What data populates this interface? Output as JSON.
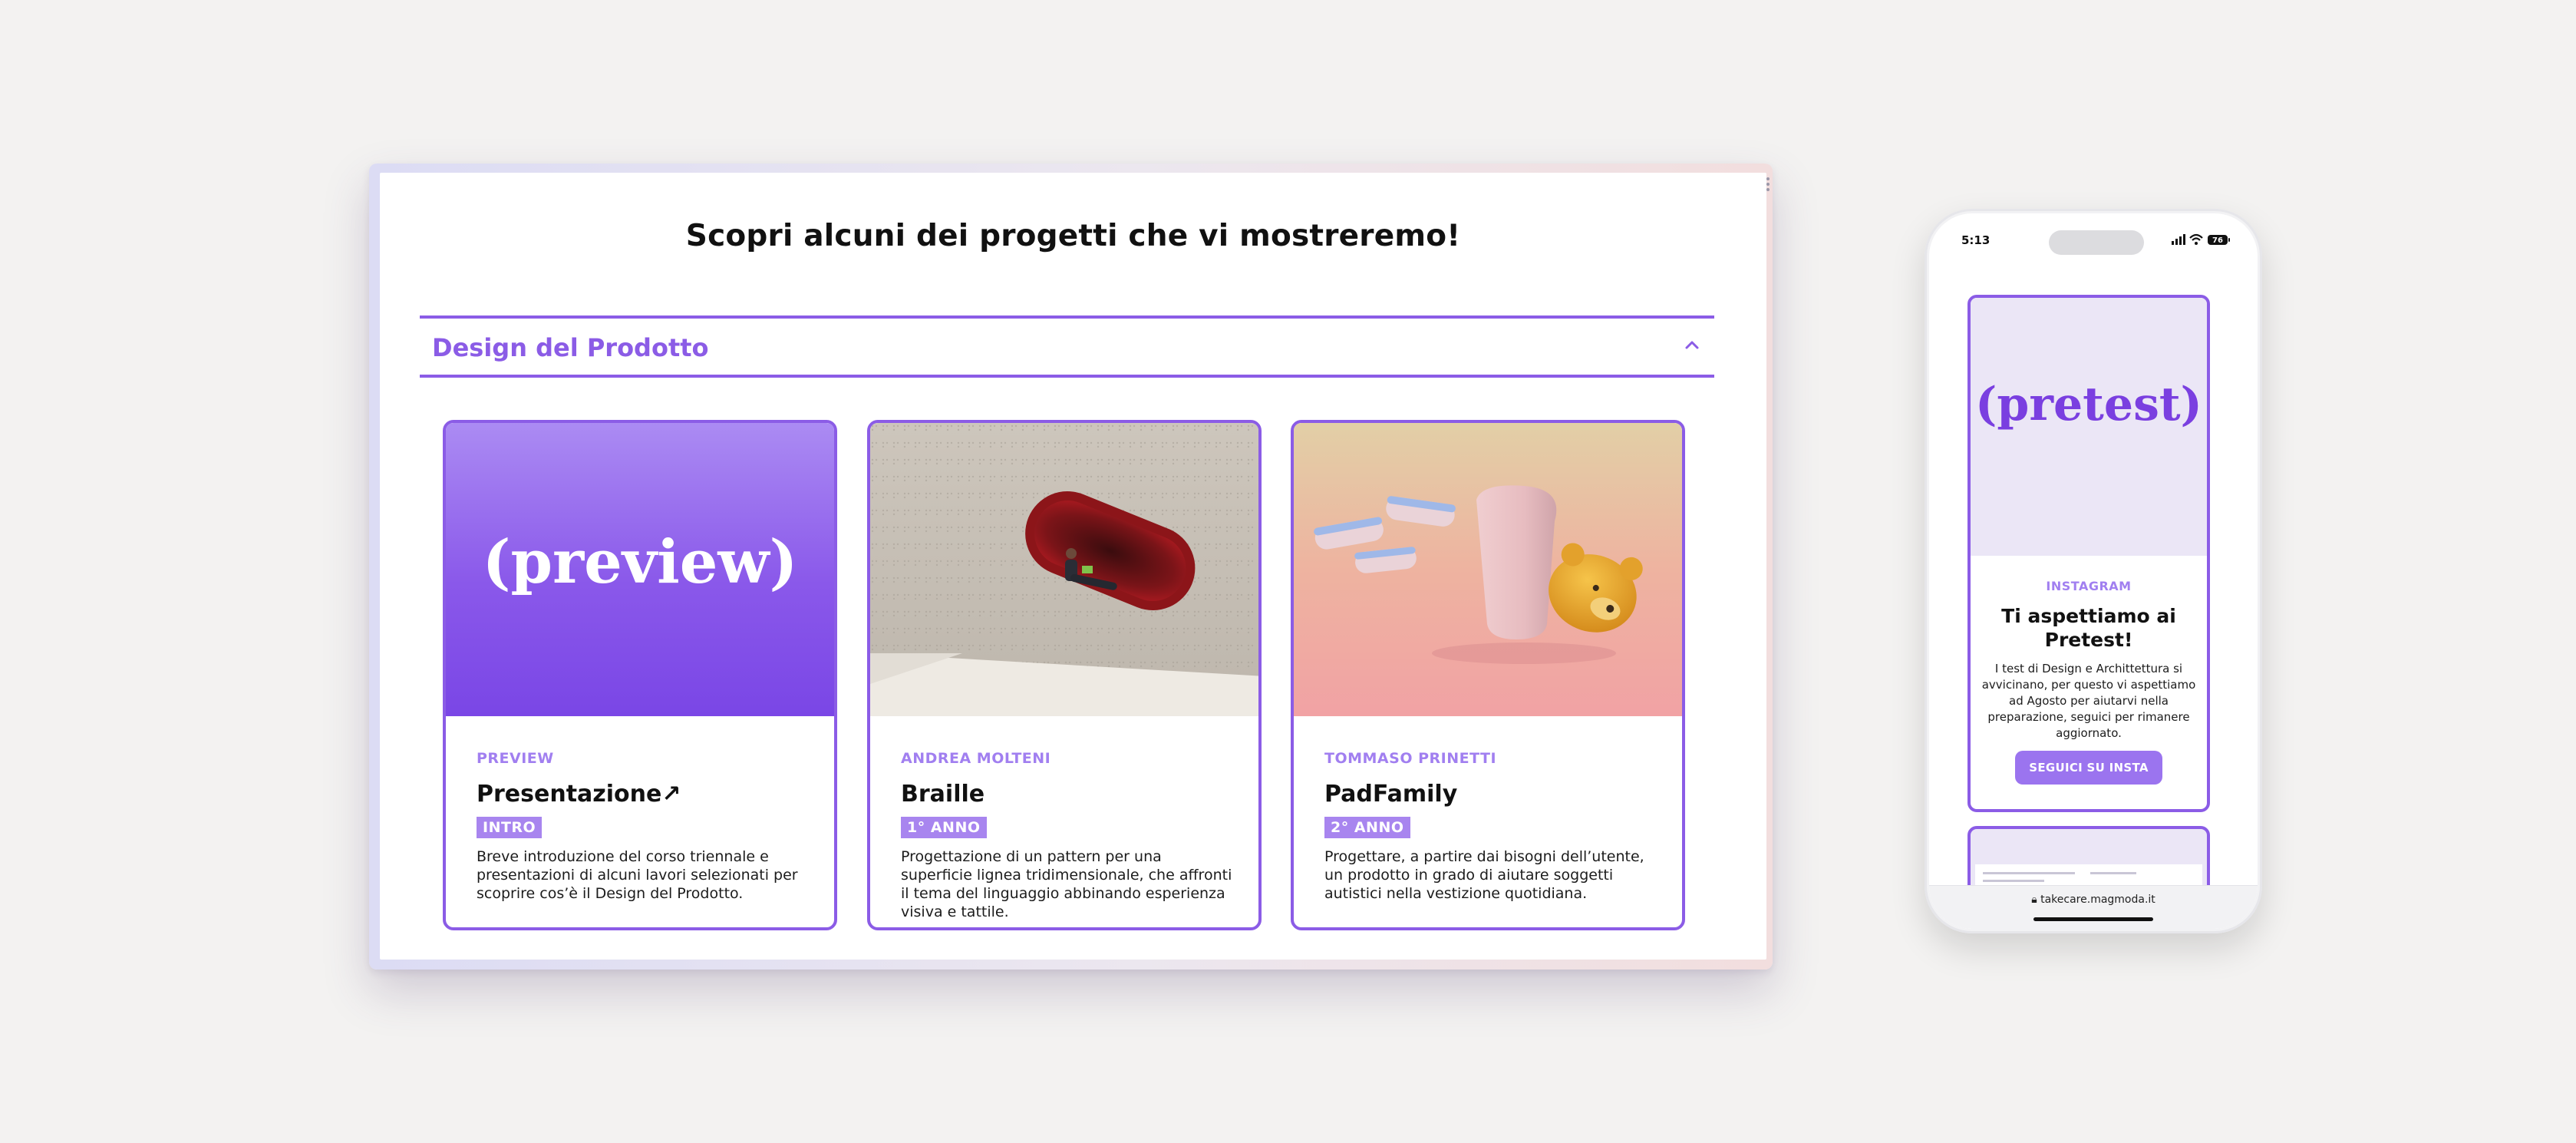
{
  "desktop": {
    "heading": "Scopri alcuni dei progetti che vi mostreremo!",
    "accordion": {
      "title": "Design del Prodotto",
      "icon": "chevron-up-icon",
      "accent_color": "#8b5ce6"
    },
    "cards": [
      {
        "image_text": "(preview)",
        "kicker": "PREVIEW",
        "title": "Presentazione",
        "title_icon": "↗",
        "badge": "INTRO",
        "description": "Breve introduzione del corso triennale e presentazioni di alcuni lavori selezionati per scoprire cos’è il Design del Prodotto."
      },
      {
        "kicker": "ANDREA MOLTENI",
        "title": "Braille",
        "badge": "1° ANNO",
        "description": "Progettazione di un pattern per una superficie lignea tridimensionale, che affronti il tema del linguaggio abbinando esperienza visiva e tattile."
      },
      {
        "kicker": "TOMMASO PRINETTI",
        "title": "PadFamily",
        "badge": "2° ANNO",
        "description": "Progettare, a partire dai bisogni dell’utente, un prodotto in grado di aiutare soggetti autistici nella vestizione quotidiana."
      }
    ]
  },
  "phone": {
    "time": "5:13",
    "battery": "76",
    "card": {
      "image_text": "(pretest)",
      "kicker": "INSTAGRAM",
      "title": "Ti aspettiamo ai Pretest!",
      "description": "I test di Design e Archittettura si avvicinano, per questo vi aspettiamo ad Agosto per aiutarvi nella preparazione, seguici per rimanere aggiornato.",
      "button": "SEGUICI SU INSTA"
    },
    "url": "takecare.magmoda.it"
  }
}
